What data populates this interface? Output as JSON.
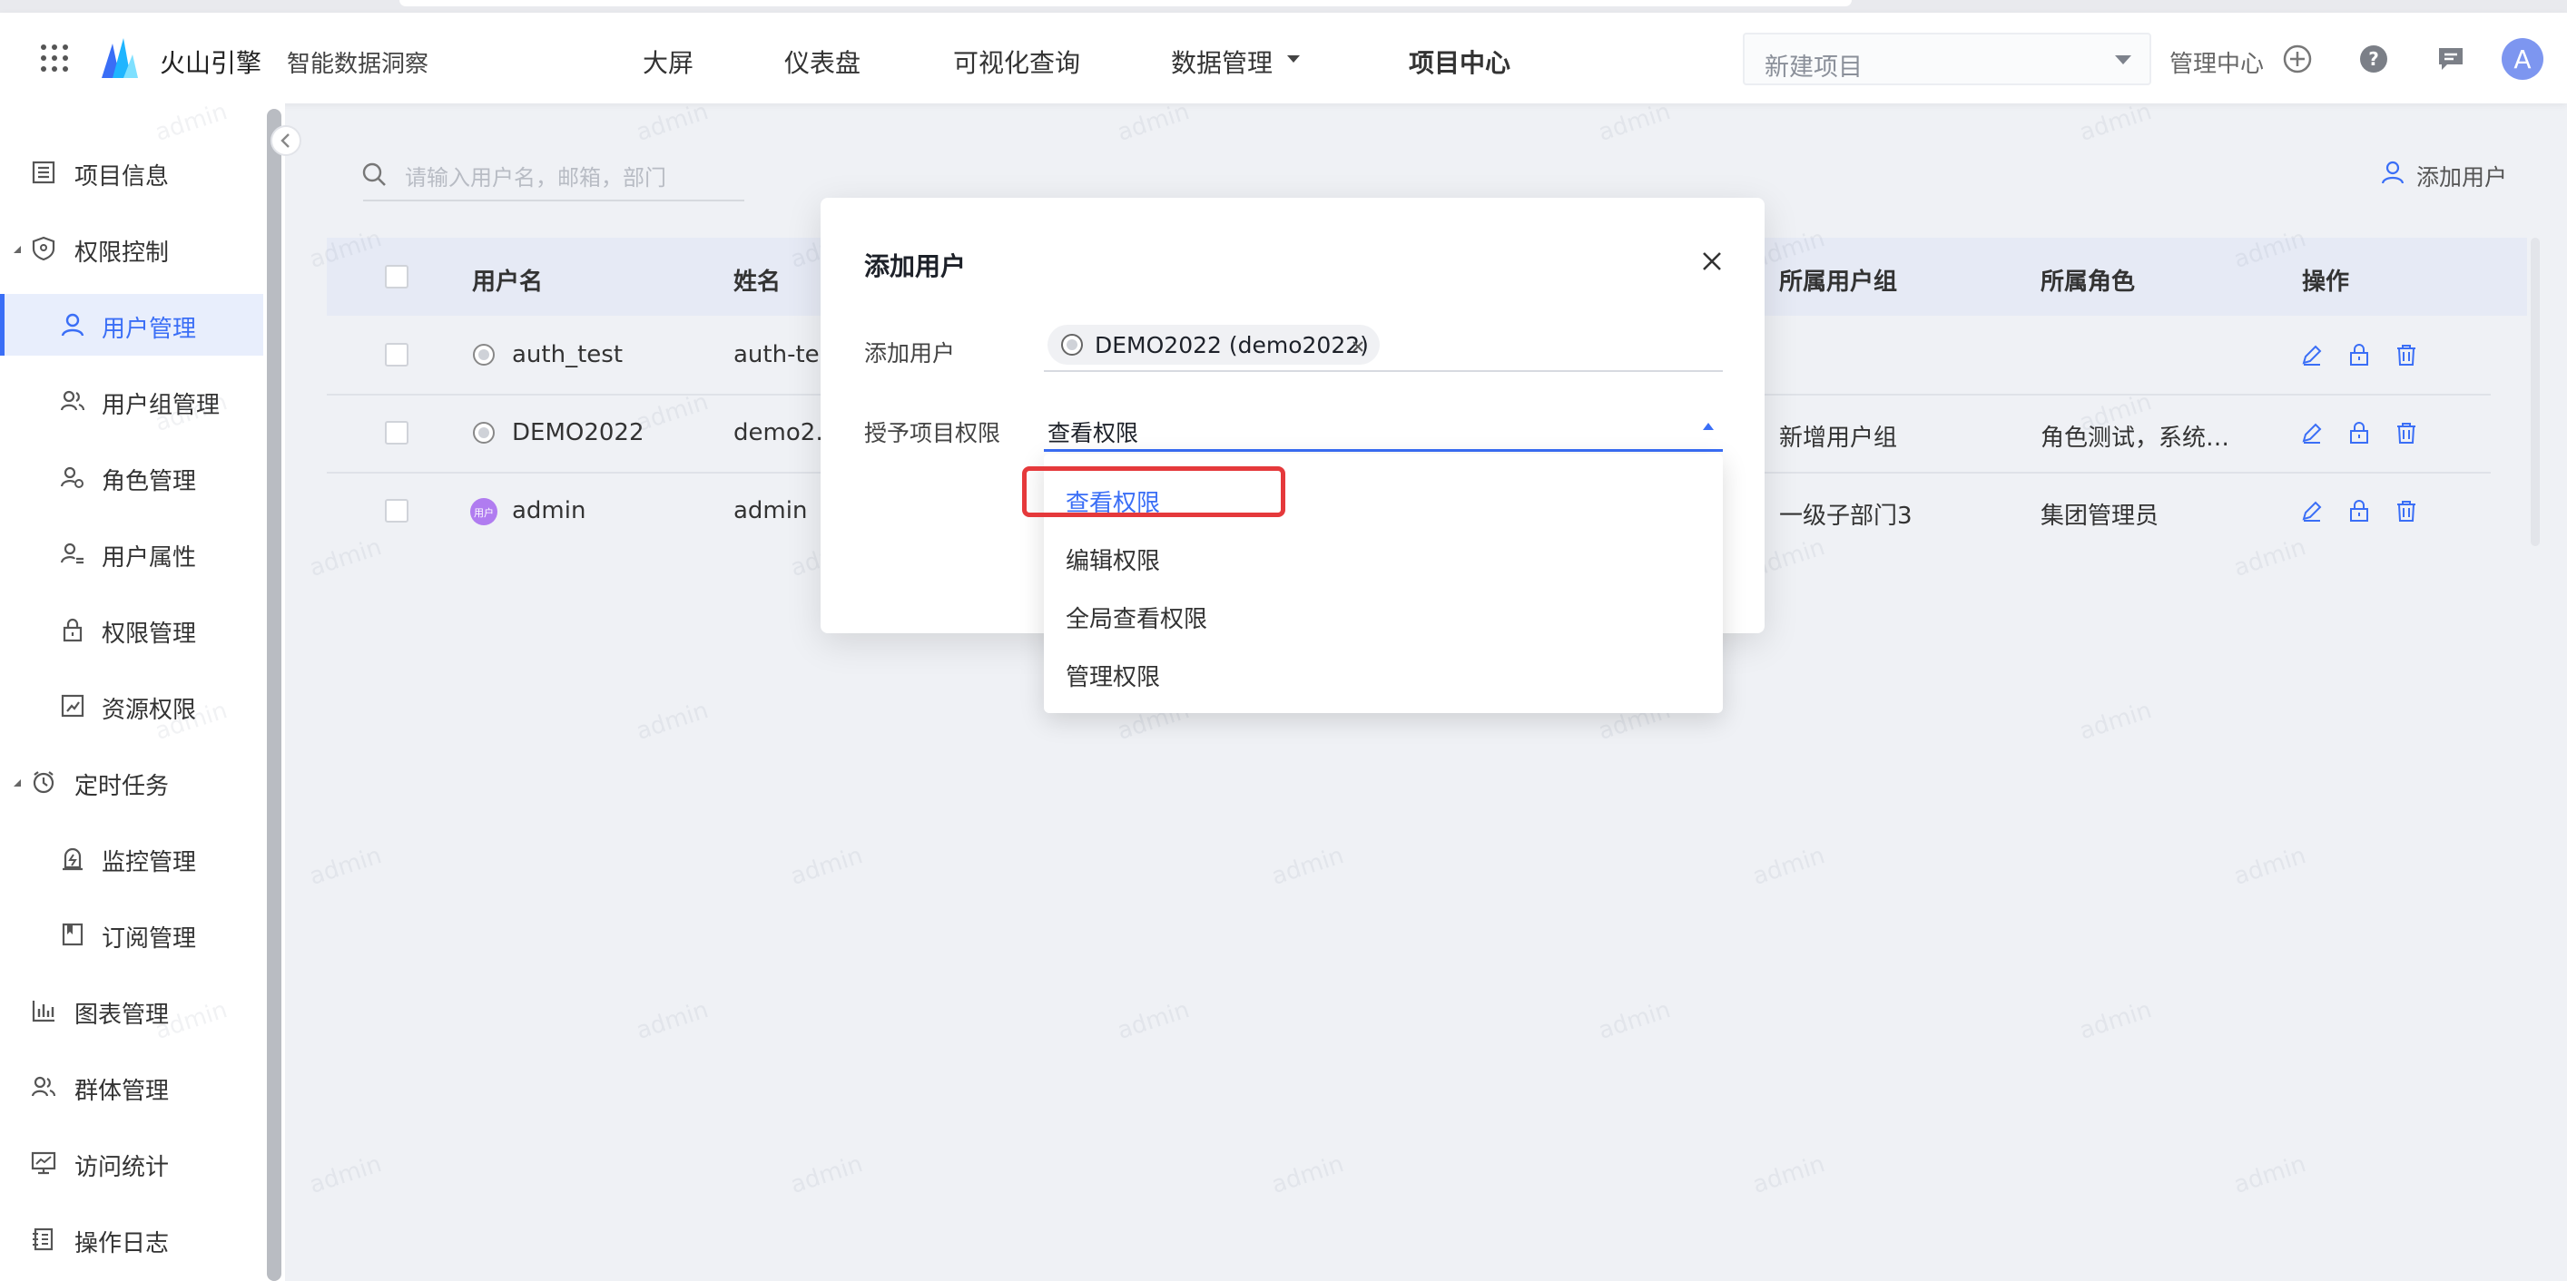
{
  "header": {
    "brand_name": "火山引擎",
    "product_name": "智能数据洞察",
    "nav": [
      {
        "label": "大屏"
      },
      {
        "label": "仪表盘"
      },
      {
        "label": "可视化查询"
      },
      {
        "label": "数据管理"
      },
      {
        "label": "项目中心"
      }
    ],
    "project_select_value": "新建项目",
    "admin_center": "管理中心",
    "avatar_letter": "A"
  },
  "sidebar": {
    "items": [
      {
        "label": "项目信息",
        "icon": "list-icon"
      },
      {
        "label": "权限控制",
        "icon": "shield-icon"
      },
      {
        "label": "用户管理",
        "icon": "user-icon"
      },
      {
        "label": "用户组管理",
        "icon": "user-group-icon"
      },
      {
        "label": "角色管理",
        "icon": "role-icon"
      },
      {
        "label": "用户属性",
        "icon": "user-attr-icon"
      },
      {
        "label": "权限管理",
        "icon": "lock-icon"
      },
      {
        "label": "资源权限",
        "icon": "resource-icon"
      },
      {
        "label": "定时任务",
        "icon": "clock-icon"
      },
      {
        "label": "监控管理",
        "icon": "monitor-icon"
      },
      {
        "label": "订阅管理",
        "icon": "bookmark-icon"
      },
      {
        "label": "图表管理",
        "icon": "chart-icon"
      },
      {
        "label": "群体管理",
        "icon": "group-icon"
      },
      {
        "label": "访问统计",
        "icon": "stats-icon"
      },
      {
        "label": "操作日志",
        "icon": "log-icon"
      }
    ]
  },
  "content": {
    "search_placeholder": "请输入用户名，邮箱，部门",
    "add_user_button": "添加用户",
    "columns": {
      "username": "用户名",
      "name": "姓名",
      "user_groups": "所属用户组",
      "roles": "所属角色",
      "actions": "操作"
    },
    "rows": [
      {
        "username": "auth_test",
        "name": "auth-test",
        "group": "",
        "role": ""
      },
      {
        "username": "DEMO2022",
        "name": "demo2…",
        "group": "新增用户组",
        "role": "角色测试，系统…"
      },
      {
        "username": "admin",
        "name": "admin",
        "group": "一级子部门3",
        "role": "集团管理员",
        "avatar_text": "用户"
      }
    ]
  },
  "modal": {
    "title": "添加用户",
    "add_user_label": "添加用户",
    "selected_user_tag": "DEMO2022 (demo2022)",
    "grant_label": "授予项目权限",
    "grant_value": "查看权限",
    "options": [
      {
        "label": "查看权限",
        "selected": true
      },
      {
        "label": "编辑权限"
      },
      {
        "label": "全局查看权限"
      },
      {
        "label": "管理权限"
      }
    ]
  },
  "watermark": "admin",
  "colors": {
    "accent": "#3a6ef6",
    "highlight_box": "#e5393b",
    "background": "#eff1f5"
  }
}
